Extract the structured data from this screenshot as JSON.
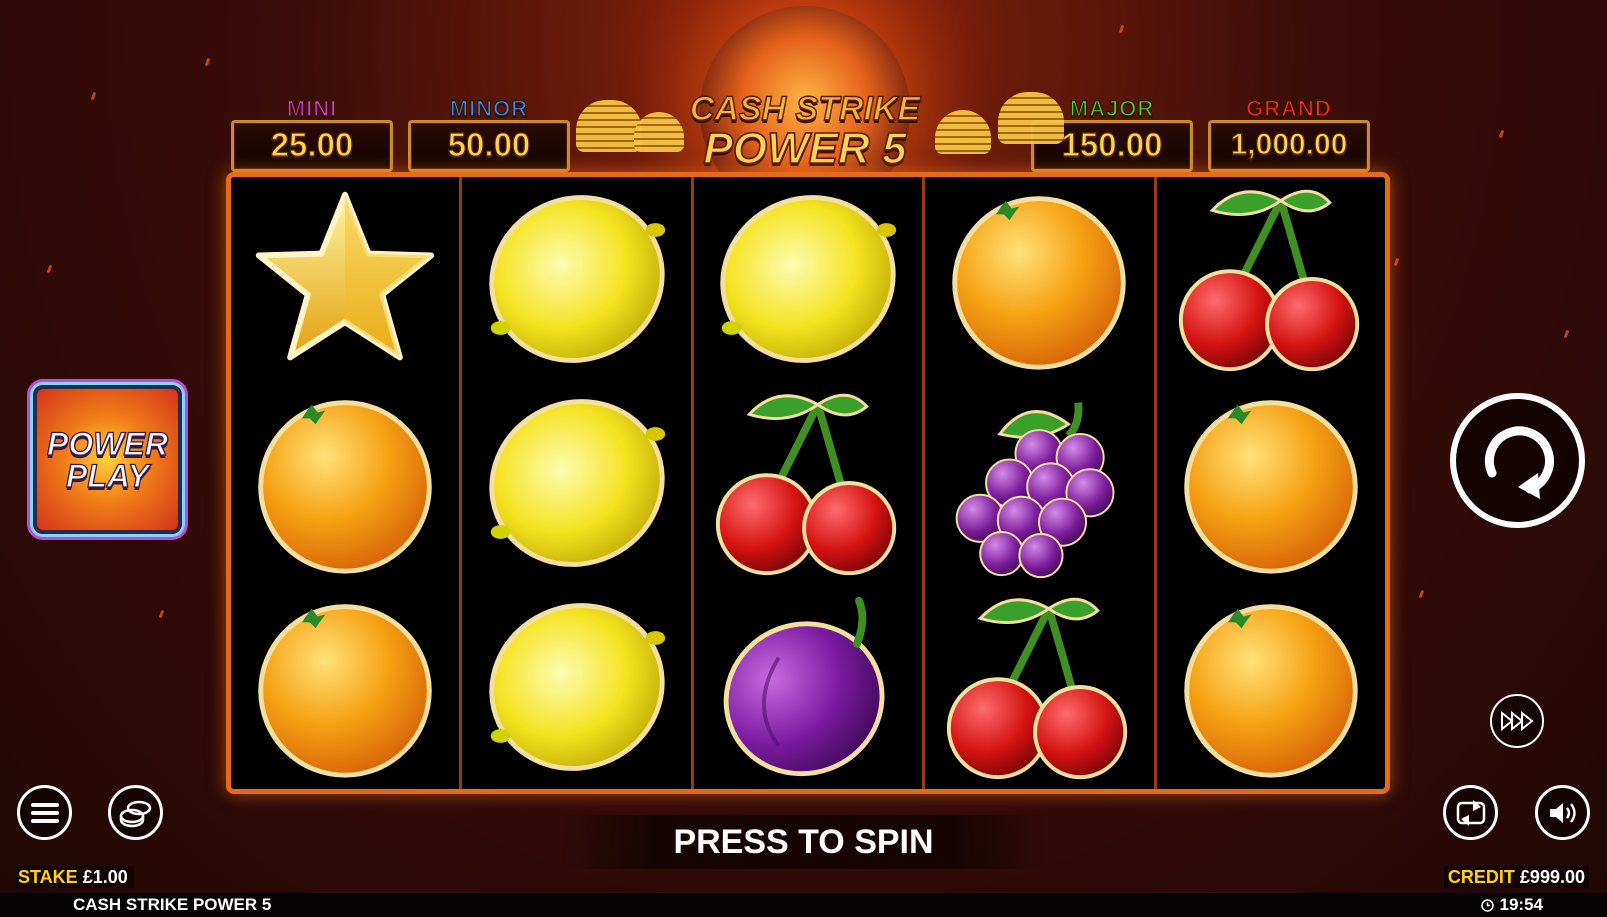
{
  "game": {
    "logo_line1": "CASH STRIKE",
    "logo_line2": "POWER 5"
  },
  "jackpots": [
    {
      "label": "MINI",
      "value": "25.00",
      "color": "#c93ad6"
    },
    {
      "label": "MINOR",
      "value": "50.00",
      "color": "#2f8bff"
    },
    {
      "label": "MAJOR",
      "value": "150.00",
      "color": "#4bd12a"
    },
    {
      "label": "GRAND",
      "value": "1,000.00",
      "color": "#ff2a2a"
    }
  ],
  "reels": [
    [
      "star",
      "orange",
      "orange"
    ],
    [
      "lemon",
      "lemon",
      "lemon"
    ],
    [
      "lemon",
      "cherry",
      "plum"
    ],
    [
      "orange",
      "grapes",
      "cherry"
    ],
    [
      "cherry",
      "orange",
      "orange"
    ]
  ],
  "power_play": {
    "line1": "POWER",
    "line2": "PLAY"
  },
  "controls": {
    "spin_icon": "spin-icon",
    "turbo_icon": "fast-forward-icon",
    "menu_icon": "menu-icon",
    "stake_icon": "coins-icon",
    "autoplay_icon": "autoplay-icon",
    "sound_icon": "sound-icon"
  },
  "press_to_spin": "PRESS TO SPIN",
  "stake": {
    "label": "STAKE",
    "value": "£1.00"
  },
  "credit": {
    "label": "CREDIT",
    "value": "£999.00"
  },
  "footer": {
    "game_name": "CASH STRIKE POWER 5",
    "time": "19:54"
  }
}
